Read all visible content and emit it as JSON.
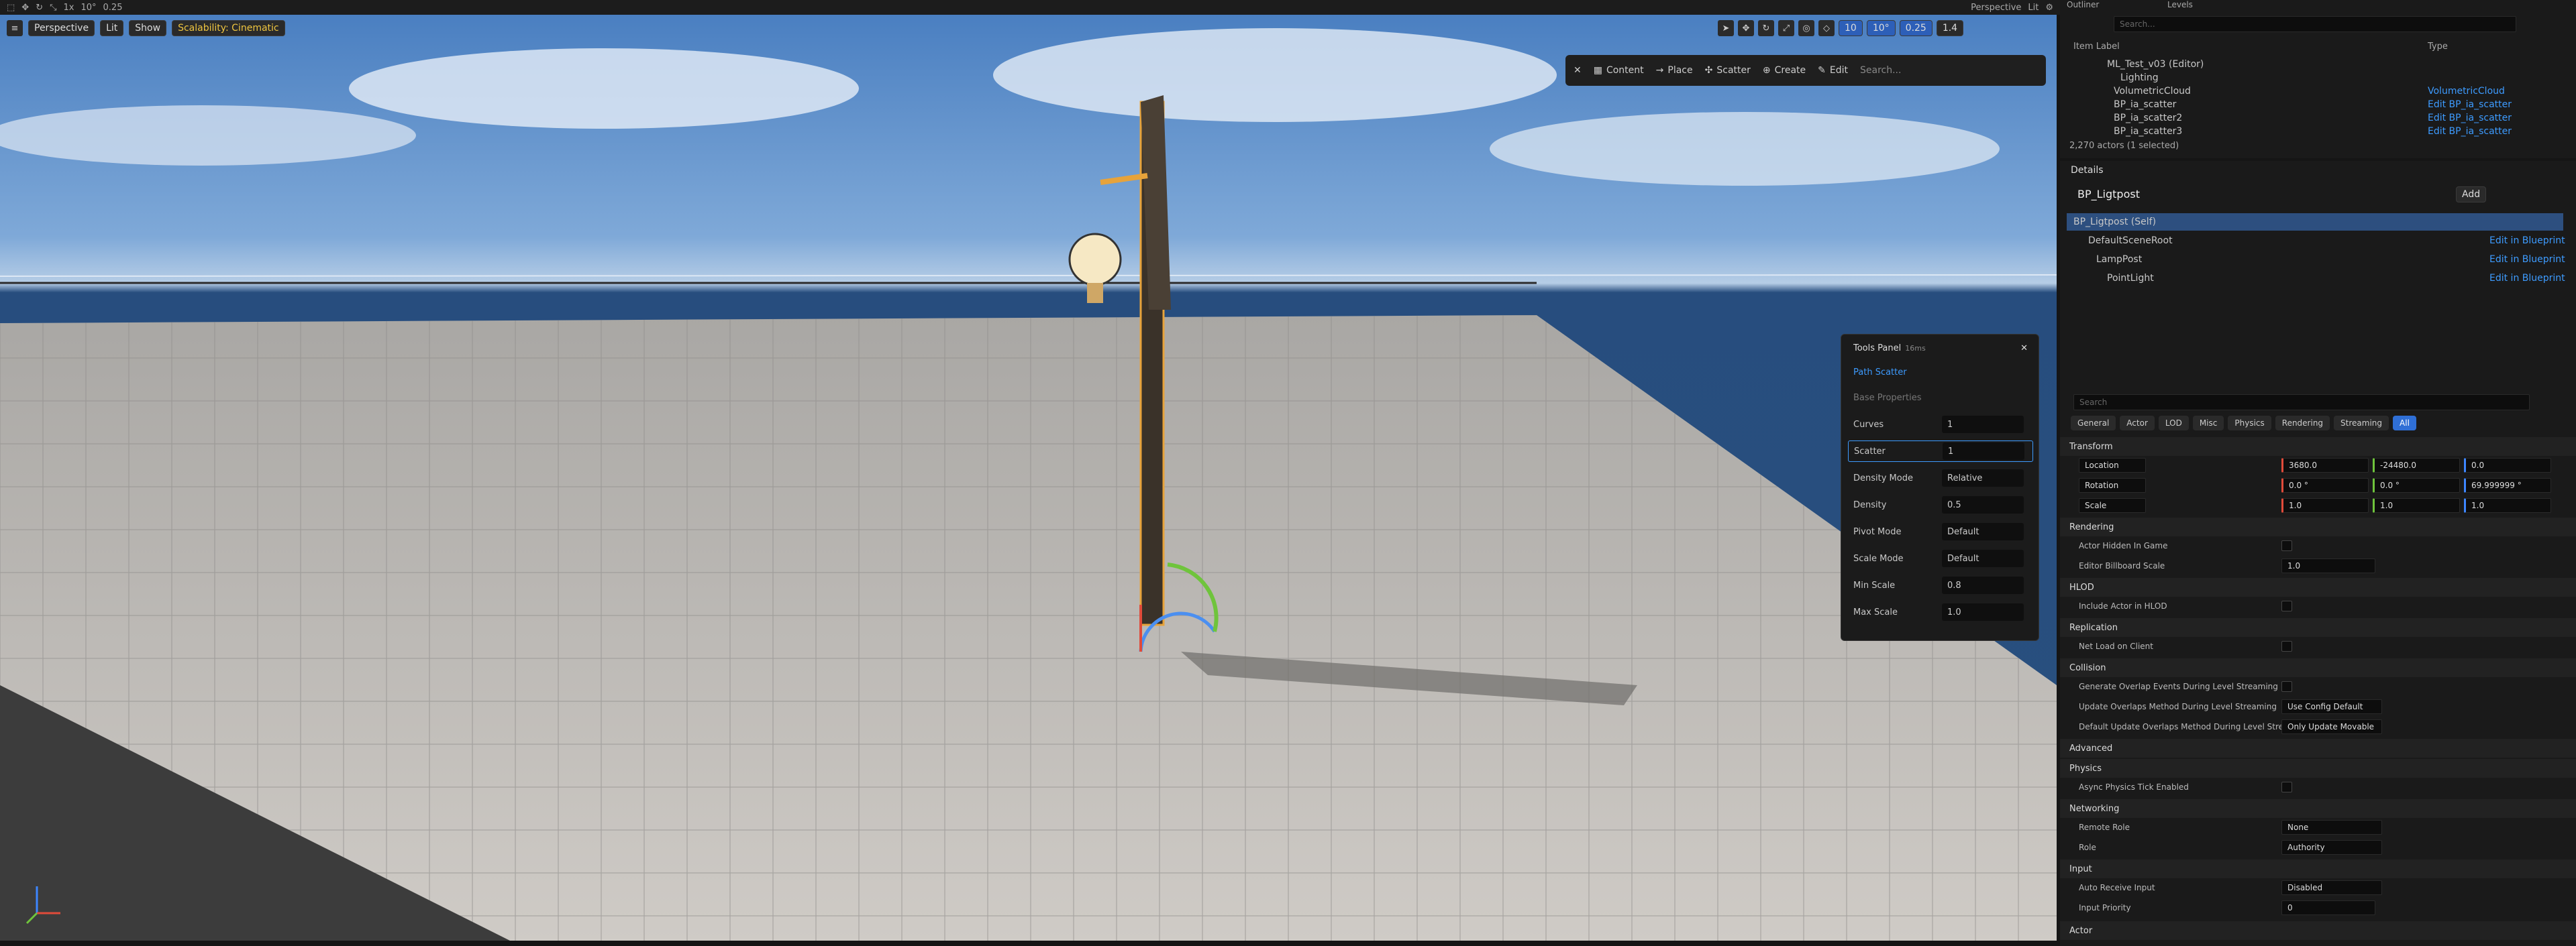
{
  "toolbar": {
    "perspective": "Perspective",
    "lit": "Lit",
    "x1": "1x",
    "snap_angle": "10°",
    "cam_speed": "0.25"
  },
  "viewport": {
    "view_btn": "Perspective",
    "lit_btn": "Lit",
    "show_btn": "Show",
    "scalability": "Scalability: Cinematic",
    "grid_snap": "10",
    "angle_snap": "10°",
    "scale_snap": "0.25",
    "cam_speed": "1.4"
  },
  "quickbar": {
    "content": "Content",
    "place": "Place",
    "scatter": "Scatter",
    "create": "Create",
    "edit": "Edit",
    "search_placeholder": "Search..."
  },
  "tools_panel": {
    "title": "Tools Panel",
    "timing": "16ms",
    "tool": "Path Scatter",
    "section": "Base Properties",
    "rows": [
      {
        "label": "Curves",
        "value": "1"
      },
      {
        "label": "Scatter",
        "value": "1"
      },
      {
        "label": "Density Mode",
        "value": "Relative"
      },
      {
        "label": "Density",
        "value": "0.5"
      },
      {
        "label": "Pivot Mode",
        "value": "Default"
      },
      {
        "label": "Scale Mode",
        "value": "Default"
      },
      {
        "label": "Min Scale",
        "value": "0.8"
      },
      {
        "label": "Max Scale",
        "value": "1.0"
      }
    ]
  },
  "outliner": {
    "tab": "Outliner",
    "tab2": "Levels",
    "search_placeholder": "Search...",
    "col_label": "Item Label",
    "col_type": "Type",
    "rows": [
      {
        "label": "ML_Test_v03 (Editor)",
        "type": ""
      },
      {
        "label": "Lighting",
        "type": ""
      },
      {
        "label": "VolumetricCloud",
        "type": "VolumetricCloud"
      },
      {
        "label": "BP_ia_scatter",
        "type": "Edit BP_ia_scatter"
      },
      {
        "label": "BP_ia_scatter2",
        "type": "Edit BP_ia_scatter"
      },
      {
        "label": "BP_ia_scatter3",
        "type": "Edit BP_ia_scatter"
      }
    ],
    "status": "2,270 actors (1 selected)"
  },
  "details": {
    "tab": "Details",
    "actor": "BP_Ligtpost",
    "add_btn": "Add",
    "components": [
      {
        "label": "BP_Ligtpost (Self)",
        "link": ""
      },
      {
        "label": "DefaultSceneRoot",
        "link": "Edit in Blueprint"
      },
      {
        "label": "LampPost",
        "link": "Edit in Blueprint"
      },
      {
        "label": "PointLight",
        "link": "Edit in Blueprint"
      }
    ],
    "search_placeholder": "Search",
    "filters": [
      "General",
      "Actor",
      "LOD",
      "Misc",
      "Physics",
      "Rendering",
      "Streaming",
      "All"
    ],
    "sections": {
      "transform": "Transform",
      "rendering": "Rendering",
      "hlod": "HLOD",
      "replication": "Replication",
      "collision": "Collision",
      "advanced": "Advanced",
      "physics": "Physics",
      "networking": "Networking",
      "input": "Input",
      "actor": "Actor"
    },
    "location": {
      "label": "Location",
      "x": "3680.0",
      "y": "-24480.0",
      "z": "0.0"
    },
    "rotation": {
      "label": "Rotation",
      "x": "0.0 °",
      "y": "0.0 °",
      "z": "69.999999 °"
    },
    "scale": {
      "label": "Scale",
      "x": "1.0",
      "y": "1.0",
      "z": "1.0"
    },
    "props": {
      "actor_hidden": "Actor Hidden In Game",
      "billboard": "Editor Billboard Scale",
      "billboard_val": "1.0",
      "include_hlod": "Include Actor in HLOD",
      "net_load": "Net Load on Client",
      "gen_overlap": "Generate Overlap Events During Level Streaming",
      "upd_overlap": "Update Overlaps Method During Level Streaming",
      "upd_overlap_val": "Use Config Default",
      "def_overlap": "Default Update Overlaps Method During Level Strea...",
      "def_overlap_val": "Only Update Movable",
      "async_phys": "Async Physics Tick Enabled",
      "remote_role": "Remote Role",
      "remote_role_val": "None",
      "role": "Role",
      "role_val": "Authority",
      "auto_input": "Auto Receive Input",
      "auto_input_val": "Disabled",
      "input_priority": "Input Priority",
      "input_priority_val": "0"
    }
  }
}
